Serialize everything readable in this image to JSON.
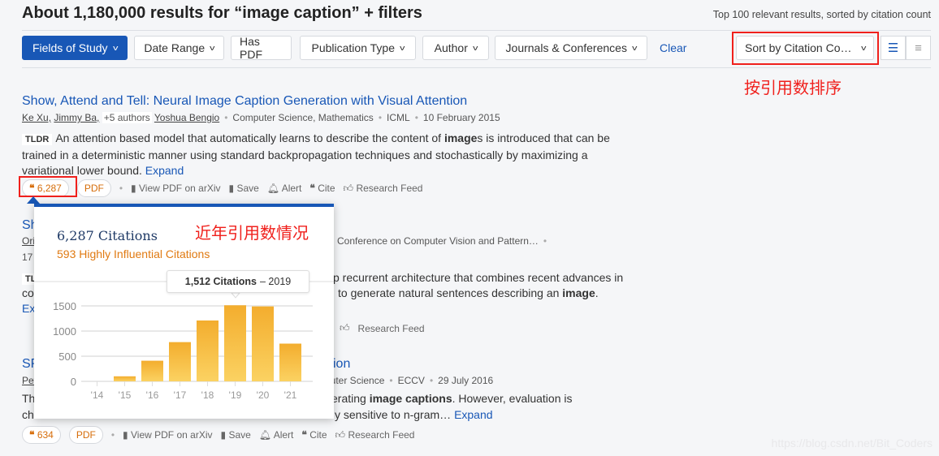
{
  "header": {
    "title": "About 1,180,000 results for “image caption” + filters",
    "subtitle": "Top 100 relevant results, sorted by citation count"
  },
  "filters": [
    {
      "label": "Fields of Study",
      "dropdown": true,
      "active": true
    },
    {
      "label": "Date Range",
      "dropdown": true
    },
    {
      "label": "Has PDF",
      "dropdown": false
    },
    {
      "label": "Publication Type",
      "dropdown": true
    },
    {
      "label": "Author",
      "dropdown": true
    },
    {
      "label": "Journals & Conferences",
      "dropdown": true
    }
  ],
  "clear_label": "Clear",
  "sort": {
    "value": "Sort by Citation Co…"
  },
  "annotations": {
    "sort_note": "按引用数排序",
    "chart_note": "近年引用数情况"
  },
  "papers": [
    {
      "title": "Show, Attend and Tell: Neural Image Caption Generation with Visual Attention",
      "authors": [
        "Ke Xu,",
        "Jimmy Ba,"
      ],
      "more_authors": "+5 authors",
      "last_author": "Yoshua Bengio",
      "fields": "Computer Science, Mathematics",
      "venue": "ICML",
      "date": "10 February 2015",
      "tldr_label": "TLDR",
      "abstract_a": "An attention based model that automatically learns to describe the content of ",
      "abstract_bold": "image",
      "abstract_b": "s is introduced that can be trained in a deterministic manner using standard backpropagation techniques and stochastically by maximizing a variational lower bound. ",
      "expand": "Expand",
      "citations": "6,287",
      "pdf": "PDF",
      "view_pdf": "View PDF on arXiv",
      "save": "Save",
      "alert": "Alert",
      "cite": "Cite",
      "feed": "Research Feed"
    },
    {
      "title_frag": "Sh",
      "author_frag": "Ori",
      "venue_frag": "Conference on Computer Vision and Pattern…",
      "date_frag": "17",
      "tldr_frag": "TL",
      "line1": "p recurrent architecture that combines recent advances in",
      "line2_a": "to generate natural sentences describing an ",
      "line2_bold": "image",
      "line2_b": ".",
      "l1_frag": "co",
      "expand_frag": "Ex",
      "feed": "Research Feed"
    },
    {
      "title_frag": "SP",
      "title_end": "ion",
      "author_frag": "Pet",
      "fields_frag": "puter Science",
      "venue": "ECCV",
      "date": "29 July 2016",
      "line1_frag": "Th",
      "line1_a": "erating ",
      "line1_bold": "image captions",
      "line1_b": ". However, evaluation is",
      "line2_frag": "ch",
      "line2": "y sensitive to n-gram… ",
      "expand": "Expand",
      "citations": "634",
      "pdf": "PDF",
      "view_pdf": "View PDF on arXiv",
      "save": "Save",
      "alert": "Alert",
      "cite": "Cite",
      "feed": "Research Feed"
    }
  ],
  "popup": {
    "total": "6,287 Citations",
    "influential": "593 Highly Influential Citations",
    "tooltip_value": "1,512 Citations",
    "tooltip_year": "– 2019"
  },
  "chart_data": {
    "type": "bar",
    "categories": [
      "'14",
      "'15",
      "'16",
      "'17",
      "'18",
      "'19",
      "'20",
      "'21"
    ],
    "values": [
      0,
      100,
      410,
      780,
      1210,
      1512,
      1490,
      750
    ],
    "ylim": [
      0,
      1500
    ],
    "yticks": [
      "0",
      "500",
      "1000",
      "1500"
    ],
    "grid": true,
    "bar_color": "#f5b335",
    "highlighted": "'19"
  },
  "watermark": "https://blog.csdn.net/Bit_Coders",
  "colors": {
    "accent": "#1857b6",
    "citation": "#d66d0a",
    "annotation": "#f0201c"
  }
}
